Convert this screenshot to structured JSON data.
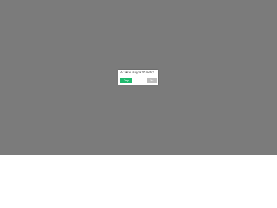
{
  "dialog": {
    "question": "Ar tikrai jau yra 20 metų?",
    "yes_label": "Taip",
    "no_label": "Ne"
  },
  "colors": {
    "overlay": "#7b7b7b",
    "dialog_background": "#ffffff",
    "yes_button": "#21b96e",
    "no_button": "#bdbdbd"
  }
}
